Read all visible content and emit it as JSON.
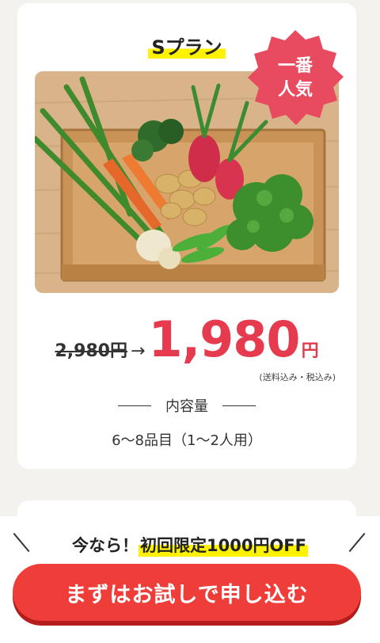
{
  "plan": {
    "title": "Sプラン",
    "badge_line1": "一番",
    "badge_line2": "人気",
    "old_price": "2,980円",
    "arrow": "→",
    "new_price": "1,980",
    "yen": "円",
    "tax_note": "(送料込み・税込み)",
    "content_heading": "内容量",
    "content_value": "6〜8品目（1〜2人用）"
  },
  "footer": {
    "promo_prefix": "今なら！",
    "promo_highlight": "初回限定1000円OFF",
    "cta_label": "まずはお試しで申し込む"
  },
  "colors": {
    "accent_red": "#e63b4f",
    "badge_red": "#e84a5f",
    "cta_red": "#ef3e3a",
    "highlight_yellow": "#fff200"
  }
}
